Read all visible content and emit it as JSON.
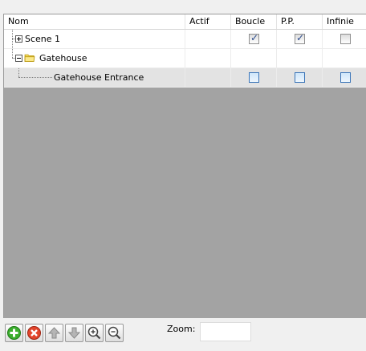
{
  "tree": {
    "columns": [
      "Nom",
      "Actif",
      "Boucle",
      "P.P.",
      "Infinie"
    ],
    "rows": [
      {
        "label": "Scene 1",
        "level": 0,
        "expander": "plus",
        "icon": "none",
        "checks": {
          "actif": null,
          "boucle": true,
          "pp": true,
          "infinie": false
        },
        "selected": false
      },
      {
        "label": "Gatehouse",
        "level": 0,
        "expander": "minus",
        "icon": "folder-icon",
        "checks": {
          "actif": null,
          "boucle": null,
          "pp": null,
          "infinie": null
        },
        "selected": false
      },
      {
        "label": "Gatehouse Entrance",
        "level": 1,
        "expander": "none",
        "icon": "none",
        "checks": {
          "actif": null,
          "boucle": false,
          "pp": false,
          "infinie": false
        },
        "selected": true
      }
    ]
  },
  "toolbar": {
    "buttons": [
      "add-icon",
      "delete-icon",
      "move-up-icon",
      "move-down-icon",
      "zoom-in-icon",
      "zoom-out-icon"
    ],
    "zoom_label": "Zoom:",
    "zoom_value": ""
  },
  "colors": {
    "empty_area": "#a3a3a3",
    "selected_row": "#e3e3e3",
    "accent_checkbox": "#3a74b8"
  }
}
